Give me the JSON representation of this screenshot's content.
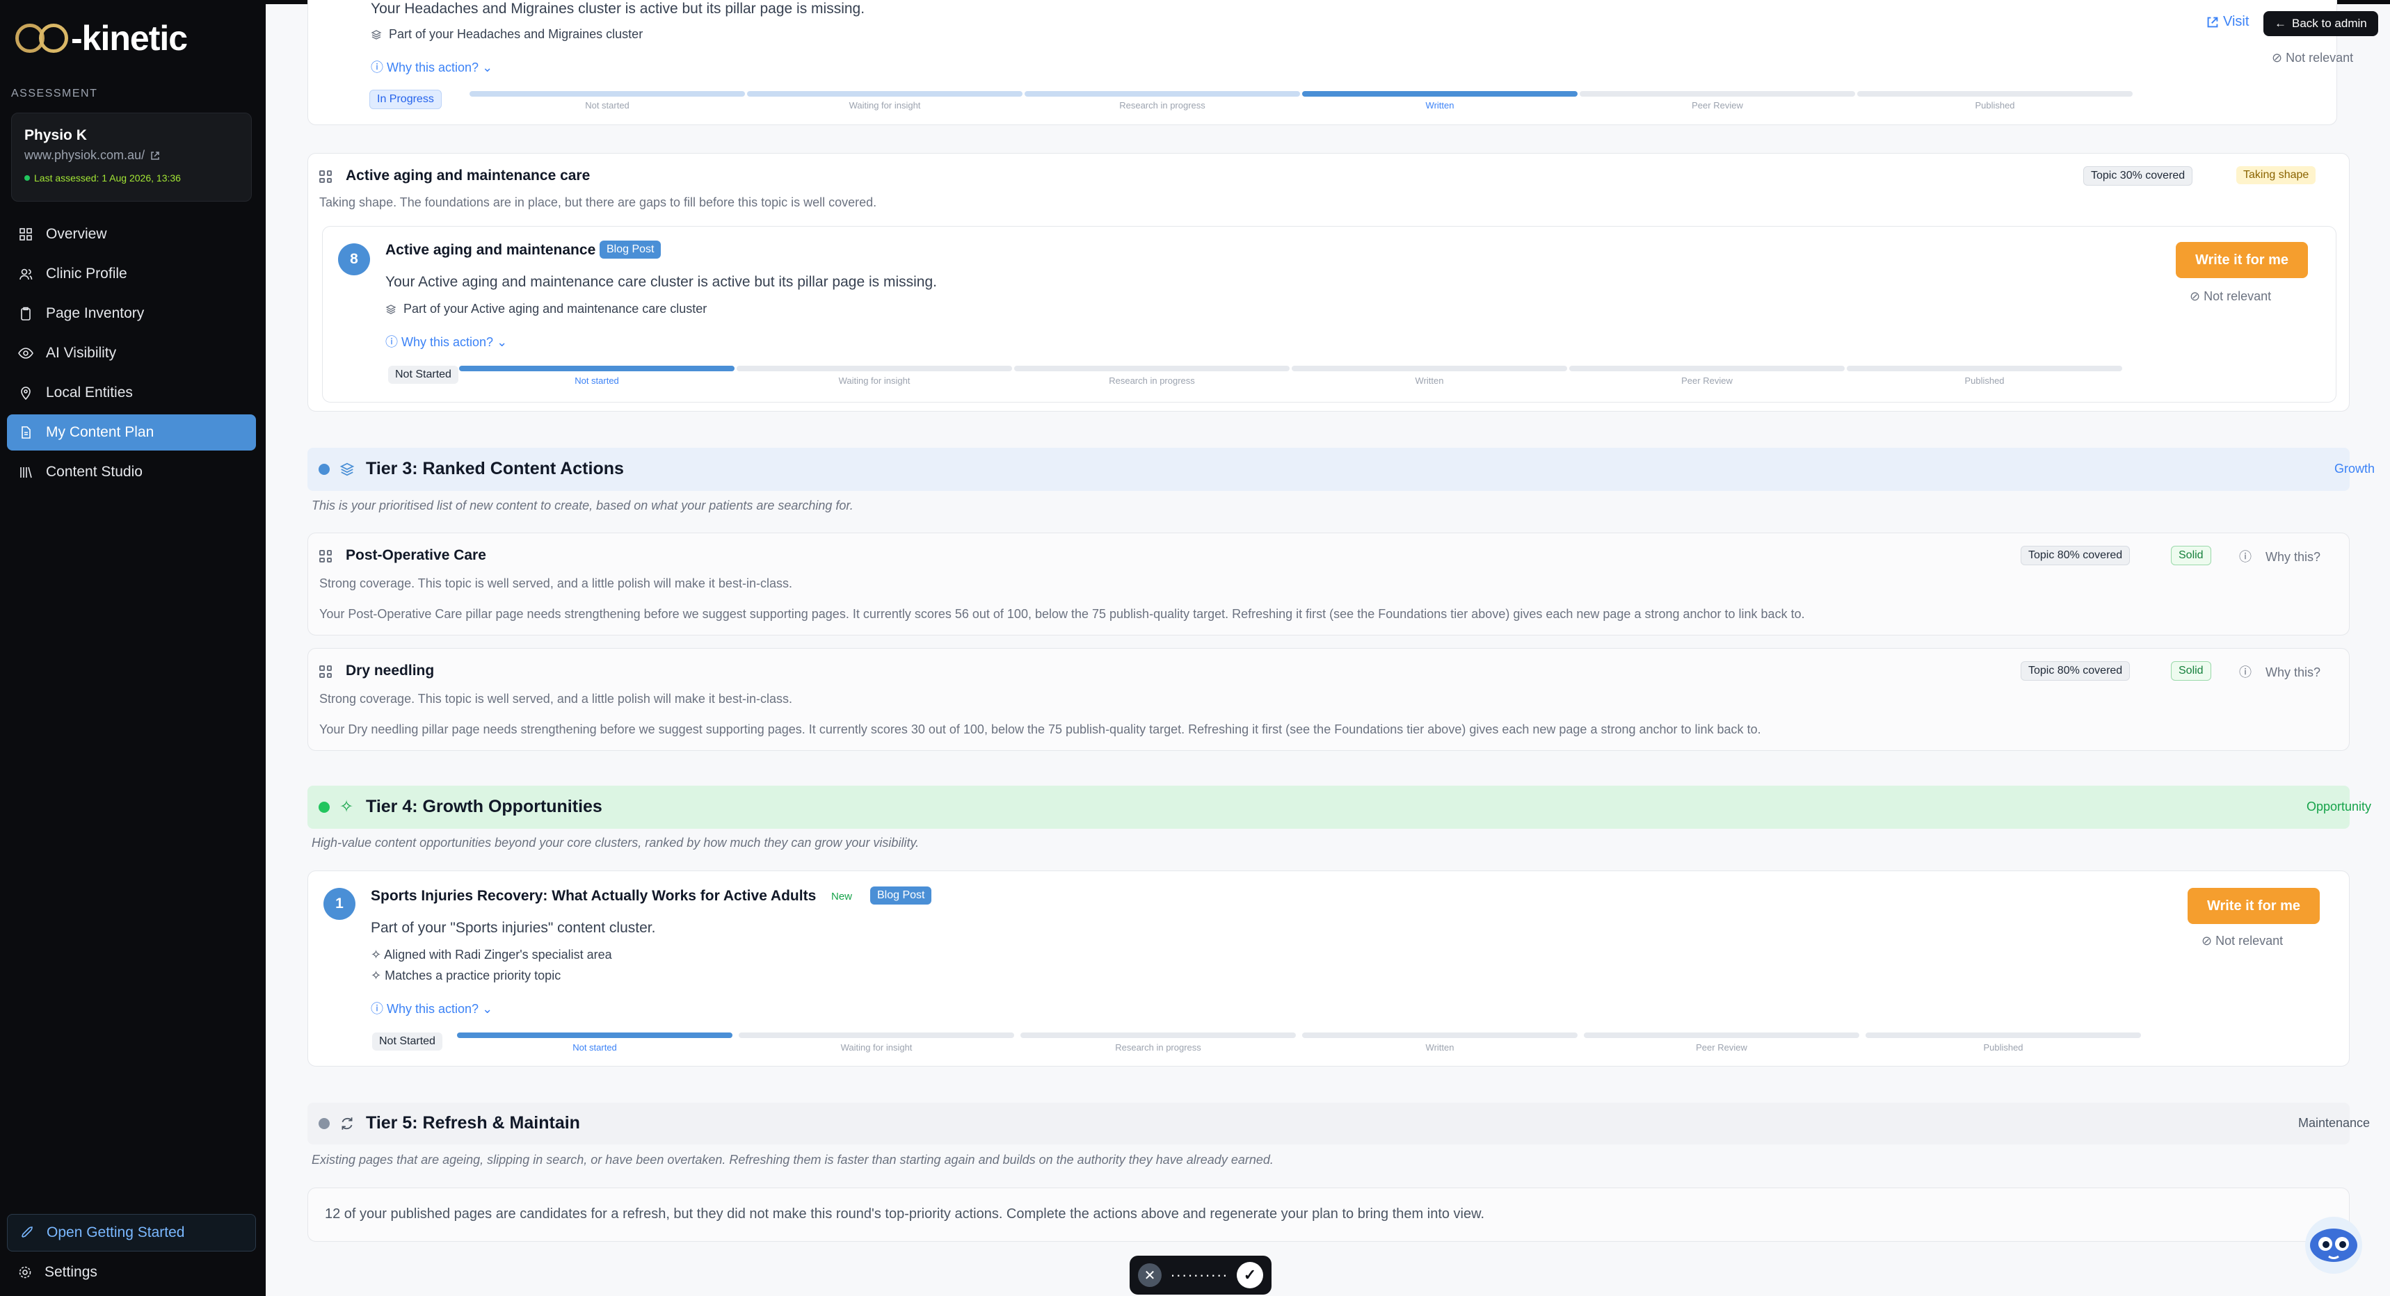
{
  "brand": {
    "logo_text": "-kinetic"
  },
  "sidebar": {
    "section_label": "ASSESSMENT",
    "clinic": {
      "name": "Physio K",
      "url": "www.physiok.com.au/",
      "assessed": "Last assessed: 1 Aug 2026, 13:36"
    },
    "items": [
      {
        "label": "Overview"
      },
      {
        "label": "Clinic Profile"
      },
      {
        "label": "Page Inventory"
      },
      {
        "label": "AI Visibility"
      },
      {
        "label": "Local Entities"
      },
      {
        "label": "My Content Plan"
      },
      {
        "label": "Content Studio"
      }
    ],
    "getting_started": "Open Getting Started",
    "settings": "Settings"
  },
  "topbar": {
    "visit": "Visit",
    "back_admin": "Back to admin"
  },
  "steps": [
    "Not started",
    "Waiting for insight",
    "Research in progress",
    "Written",
    "Peer Review",
    "Published"
  ],
  "headaches_card": {
    "line": "Your Headaches and Migraines cluster is active but its pillar page is missing.",
    "part_of": "Part of your Headaches and Migraines cluster",
    "why": "Why this action?",
    "status": "In Progress",
    "not_relevant": "Not relevant"
  },
  "aging_group": {
    "title": "Active aging and maintenance care",
    "desc": "Taking shape. The foundations are in place, but there are gaps to fill before this topic is well covered.",
    "coverage": "Topic 30% covered",
    "state": "Taking shape",
    "action": {
      "number": "8",
      "title": "Active aging and maintenance care",
      "type": "Blog Post",
      "line": "Your Active aging and maintenance care cluster is active but its pillar page is missing.",
      "part_of": "Part of your Active aging and maintenance care cluster",
      "why": "Why this action?",
      "status": "Not Started",
      "cta": "Write it for me",
      "not_relevant": "Not relevant"
    }
  },
  "tier3": {
    "title": "Tier 3: Ranked Content Actions",
    "tag": "Growth",
    "desc": "This is your prioritised list of new content to create, based on what your patients are searching for.",
    "topics": [
      {
        "title": "Post-Operative Care",
        "coverage": "Topic 80% covered",
        "state": "Solid",
        "why": "Why this?",
        "summary": "Strong coverage. This topic is well served, and a little polish will make it best-in-class.",
        "detail": "Your Post-Operative Care pillar page needs strengthening before we suggest supporting pages. It currently scores 56 out of 100, below the 75 publish-quality target. Refreshing it first (see the Foundations tier above) gives each new page a strong anchor to link back to."
      },
      {
        "title": "Dry needling",
        "coverage": "Topic 80% covered",
        "state": "Solid",
        "why": "Why this?",
        "summary": "Strong coverage. This topic is well served, and a little polish will make it best-in-class.",
        "detail": "Your Dry needling pillar page needs strengthening before we suggest supporting pages. It currently scores 30 out of 100, below the 75 publish-quality target. Refreshing it first (see the Foundations tier above) gives each new page a strong anchor to link back to."
      }
    ]
  },
  "tier4": {
    "title": "Tier 4: Growth Opportunities",
    "tag": "Opportunity",
    "desc": "High-value content opportunities beyond your core clusters, ranked by how much they can grow your visibility.",
    "action": {
      "number": "1",
      "title": "Sports Injuries Recovery: What Actually Works for Active Adults",
      "new": "New",
      "type": "Blog Post",
      "line": "Part of your \"Sports injuries\" content cluster.",
      "reasons": [
        "Aligned with Radi Zinger's specialist area",
        "Matches a practice priority topic"
      ],
      "why": "Why this action?",
      "status": "Not Started",
      "cta": "Write it for me",
      "not_relevant": "Not relevant"
    }
  },
  "tier5": {
    "title": "Tier 5: Refresh & Maintain",
    "tag": "Maintenance",
    "desc": "Existing pages that are ageing, slipping in search, or have been overtaken. Refreshing them is faster than starting again and builds on the authority they have already earned.",
    "note": "12 of your published pages are candidates for a refresh, but they did not make this round's top-priority actions. Complete the actions above and regenerate your plan to bring them into view."
  },
  "floatbar": {
    "dots": "··········"
  },
  "colors": {
    "accent": "#4a8fd6",
    "cta": "#f59e2e",
    "sidebar": "#0b0c0f"
  }
}
